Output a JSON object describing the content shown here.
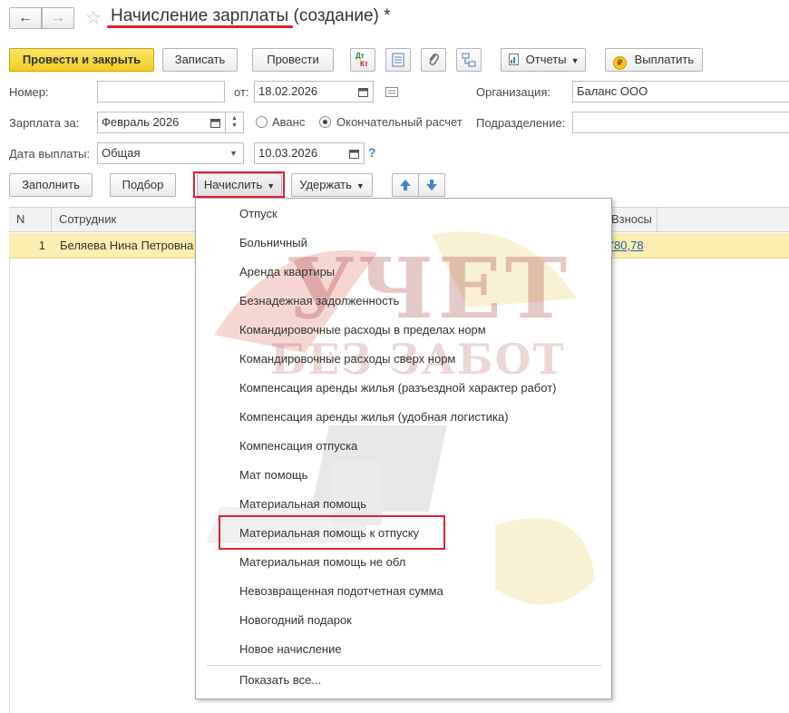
{
  "title": "Начисление зарплаты (создание) *",
  "nav": {
    "back": "←",
    "forward": "→",
    "star": "☆"
  },
  "toolbar": {
    "post_close": "Провести и закрыть",
    "save": "Записать",
    "post": "Провести",
    "dtkt_top": "Дт",
    "dtkt_bottom": "Кт",
    "reports": "Отчеты",
    "pay": "Выплатить"
  },
  "form": {
    "number_label": "Номер:",
    "number_value": "",
    "from_label": "от:",
    "from_date": "18.02.2026",
    "org_label": "Организация:",
    "org_value": "Баланс ООО",
    "salary_for_label": "Зарплата за:",
    "salary_for_value": "Февраль 2026",
    "advance_label": "Аванс",
    "final_label": "Окончательный расчет",
    "division_label": "Подразделение:",
    "division_value": "",
    "pay_date_label": "Дата выплаты:",
    "pay_date_type": "Общая",
    "pay_date": "10.03.2026",
    "help": "?"
  },
  "table_toolbar": {
    "fill": "Заполнить",
    "select": "Подбор",
    "accrue": "Начислить",
    "withhold": "Удержать"
  },
  "table": {
    "headers": {
      "n": "N",
      "employee": "Сотрудник",
      "contrib": "Взносы"
    },
    "rows": [
      {
        "n": "1",
        "employee": "Беляева Нина Петровна",
        "contrib": "2 780,78"
      }
    ]
  },
  "menu": {
    "items": [
      "Отпуск",
      "Больничный",
      "Аренда квартиры",
      "Безнадежная задолженность",
      "Командировочные расходы в пределах норм",
      "Командировочные расходы сверх норм",
      "Компенсация аренды жилья (разъездной характер работ)",
      "Компенсация аренды жилья (удобная логистика)",
      "Компенсация отпуска",
      "Мат помощь",
      "Материальная помощь",
      "Материальная помощь к отпуску",
      "Материальная помощь не обл",
      "Невозвращенная подотчетная сумма",
      "Новогодний подарок",
      "Новое начисление"
    ],
    "highlighted_index": 11,
    "show_all": "Показать все..."
  },
  "watermark": {
    "line1": "УЧЕТ",
    "line2": "БЕЗ ЗАБОТ"
  },
  "colors": {
    "accent_yellow": "#f2cf1f",
    "highlight_red": "#d9232e",
    "row_yellow": "#fbeeb0"
  }
}
